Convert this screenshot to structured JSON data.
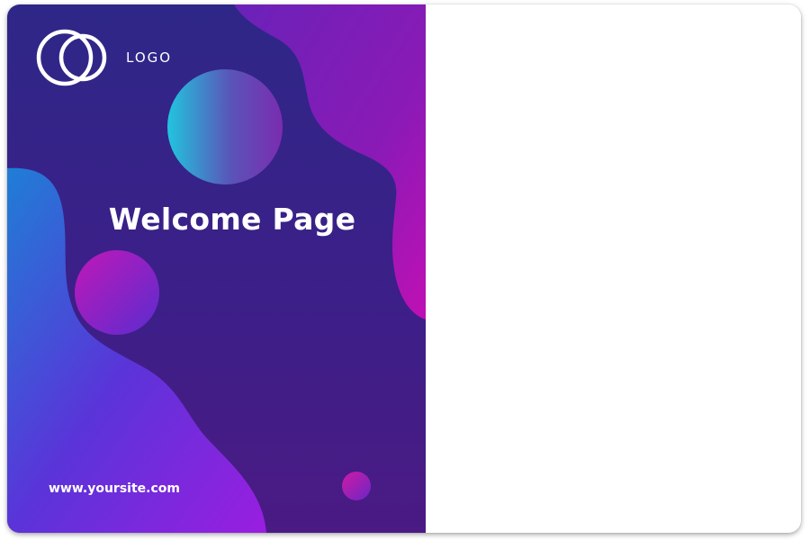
{
  "card": {
    "logo_label": "LOGO",
    "title": "Welcome Page",
    "website": "www.yoursite.com"
  },
  "icons": {
    "logo": "two-interlocking-rings-icon"
  },
  "colors": {
    "background_deep_indigo": "#3a1f8a",
    "accent_magenta": "#b512b8",
    "accent_blue": "#1f7bd6",
    "accent_cyan": "#1fc0dc",
    "accent_violet": "#8a1fd8",
    "text_white": "#ffffff",
    "right_panel": "#ffffff"
  }
}
